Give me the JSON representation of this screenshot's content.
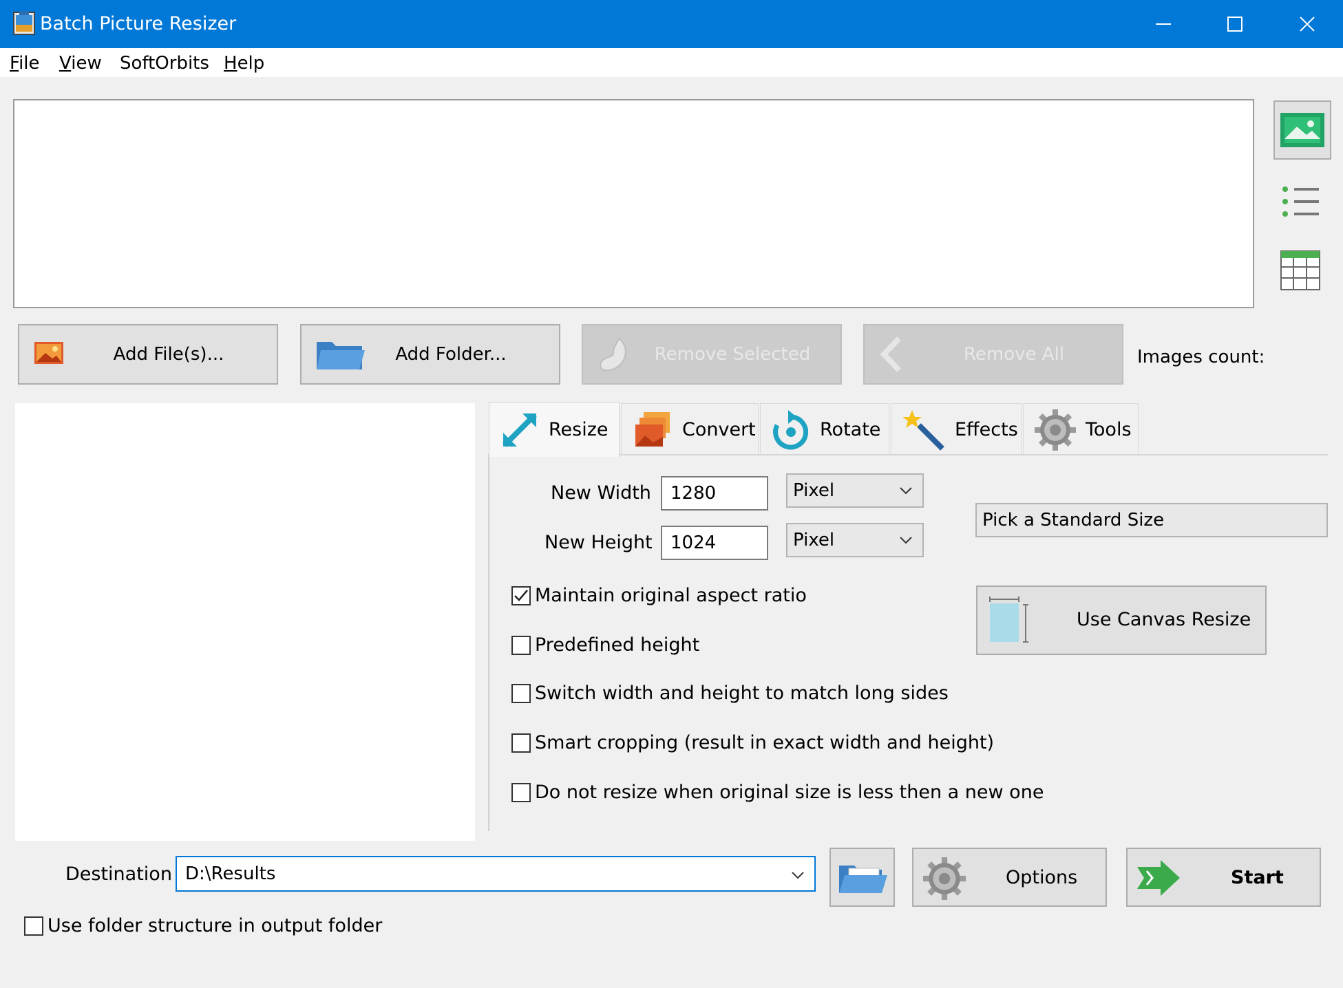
{
  "window": {
    "title": "Batch Picture Resizer",
    "controls": [
      "minimize",
      "maximize",
      "close"
    ],
    "accent": "#0078d7"
  },
  "menu": [
    {
      "label": "File",
      "underline": "F",
      "rest": "ile"
    },
    {
      "label": "View",
      "underline": "V",
      "rest": "iew"
    },
    {
      "label": "SoftOrbits",
      "underline": "",
      "rest": "SoftOrbits"
    },
    {
      "label": "Help",
      "underline": "H",
      "rest": "elp"
    }
  ],
  "view_modes": [
    "thumbnails-view-icon",
    "list-view-icon",
    "table-view-icon"
  ],
  "file_buttons": {
    "add_files": "Add File(s)...",
    "add_folder": "Add Folder...",
    "remove_selected": "Remove Selected",
    "remove_all": "Remove All"
  },
  "images_count_label": "Images count:",
  "tabs": [
    {
      "label": "Resize",
      "icon": "resize-arrow-icon",
      "active": true
    },
    {
      "label": "Convert",
      "icon": "convert-images-icon",
      "active": false
    },
    {
      "label": "Rotate",
      "icon": "rotate-icon",
      "active": false
    },
    {
      "label": "Effects",
      "icon": "magic-wand-icon",
      "active": false
    },
    {
      "label": "Tools",
      "icon": "gear-icon",
      "active": false
    }
  ],
  "resize": {
    "width_label": "New Width",
    "width_value": "1280",
    "width_unit": "Pixel",
    "height_label": "New Height",
    "height_value": "1024",
    "height_unit": "Pixel",
    "standard_size": "Pick a Standard Size",
    "canvas_button": "Use Canvas Resize",
    "options": [
      {
        "label": "Maintain original aspect ratio",
        "checked": true
      },
      {
        "label": "Predefined height",
        "checked": false
      },
      {
        "label": "Switch width and height to match long sides",
        "checked": false
      },
      {
        "label": "Smart cropping (result in exact width and height)",
        "checked": false
      },
      {
        "label": "Do not resize when original size is less then a new one",
        "checked": false
      }
    ]
  },
  "destination": {
    "label": "Destination",
    "value": "D:\\Results",
    "use_folder_structure": {
      "label": "Use folder structure in output folder",
      "checked": false
    }
  },
  "actions": {
    "options": "Options",
    "start": "Start"
  }
}
